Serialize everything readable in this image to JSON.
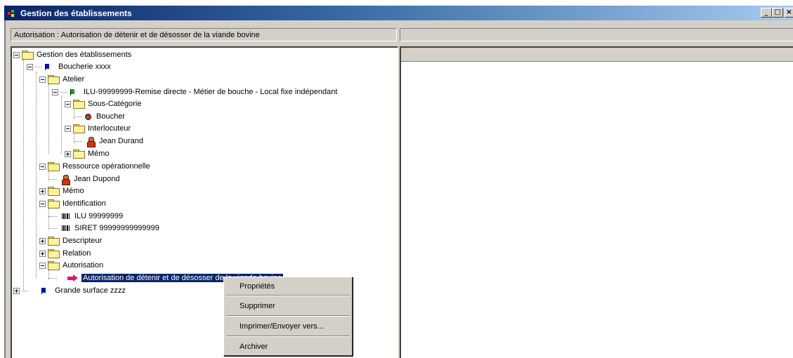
{
  "window": {
    "title": "Gestion des établissements",
    "minimize_label": "_",
    "maximize_label": "□",
    "close_label": "×"
  },
  "header": {
    "left_label": "Autorisation : Autorisation de détenir et de désosser de la viande bovine"
  },
  "tree": {
    "root": "Gestion des établissements",
    "boucherie": "Boucherie xxxx",
    "atelier": "Atelier",
    "ilu_entry": "ILU-99999999-Remise directe - Métier de bouche - Local fixe indépendant",
    "sous_categorie": "Sous-Catégorie",
    "boucher": "Boucher",
    "interlocuteur": "Interlocuteur",
    "jean_durand": "Jean Durand",
    "memo_inner": "Mémo",
    "ressource": "Ressource opérationnelle",
    "jean_dupond": "Jean Dupond",
    "memo": "Mémo",
    "identification": "Identification",
    "ilu": "ILU 99999999",
    "siret": "SIRET 99999999999999",
    "descripteur": "Descripteur",
    "relation": "Relation",
    "autorisation": "Autorisation",
    "autorisation_item": "Autorisation de détenir et de désosser de la viande bovine",
    "grande_surface": "Grande surface zzzz"
  },
  "context_menu": {
    "items": [
      "Propriétés",
      "Supprimer",
      "Imprimer/Envoyer vers...",
      "Archiver"
    ]
  },
  "icons": {
    "app": "app-icon",
    "folder": "folder-icon",
    "establishment": "flag-icon",
    "person": "person-icon",
    "category": "pie-icon",
    "identifier": "barcode-icon",
    "authorization": "arrow-icon"
  },
  "colors": {
    "titlebar_start": "#0a246a",
    "titlebar_end": "#a6caf0",
    "selection": "#0a246a",
    "chrome": "#d4d0c8"
  }
}
